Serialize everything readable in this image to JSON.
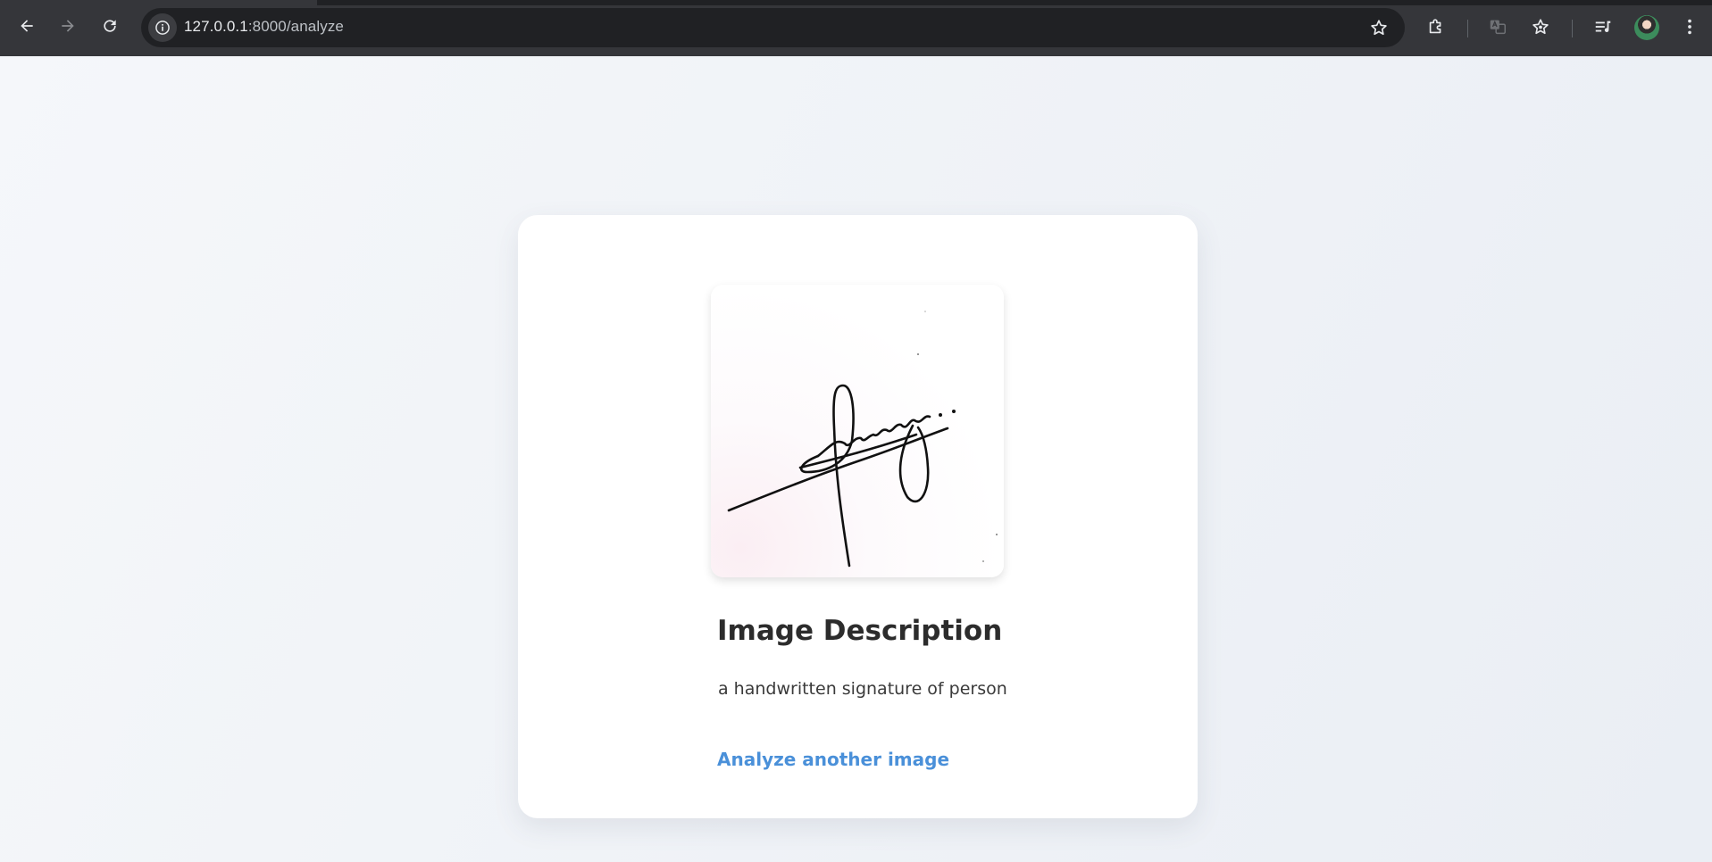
{
  "browser": {
    "url_host": "127.0.0.1",
    "url_path": ":8000/analyze",
    "icons": {
      "back": "arrow-left-icon",
      "forward": "arrow-right-icon",
      "reload": "reload-icon",
      "site_info": "info-icon",
      "bookmark": "star-icon",
      "extensions": "puzzle-icon",
      "translate": "translate-icon",
      "favorites": "star-list-icon",
      "media": "media-queue-icon",
      "menu": "kebab-menu-icon"
    }
  },
  "page": {
    "image_alt": "uploaded signature image",
    "heading": "Image Description",
    "description": "a handwritten signature of person",
    "link_label": "Analyze another image"
  },
  "colors": {
    "link": "#4a90d9",
    "heading": "#2c2c2c",
    "chrome_bg": "#35363a"
  }
}
